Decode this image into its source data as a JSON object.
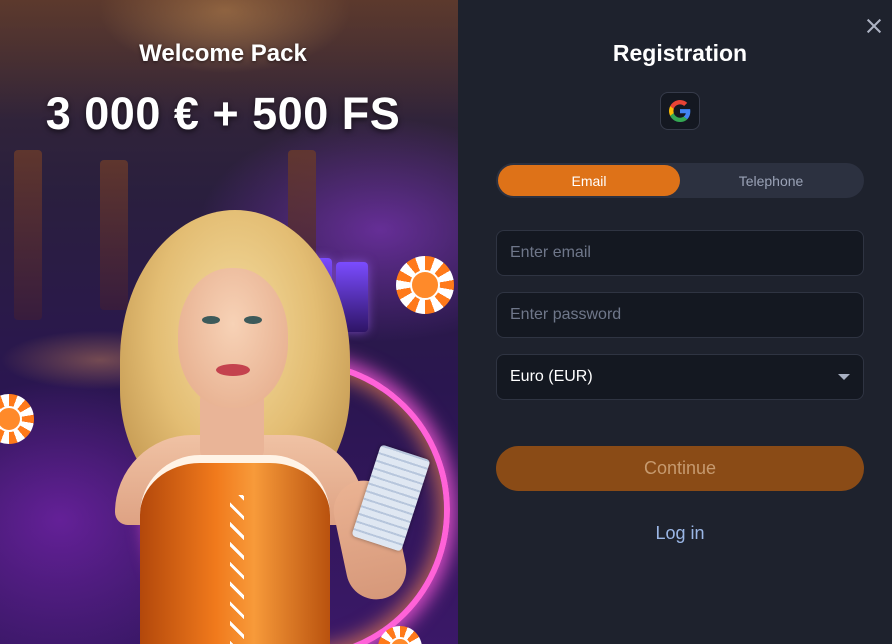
{
  "promo": {
    "title": "Welcome Pack",
    "amount": "3 000 € + 500 FS"
  },
  "registration": {
    "title": "Registration",
    "social": {
      "provider_icon": "google-icon"
    },
    "tabs": [
      {
        "label": "Email",
        "active": true
      },
      {
        "label": "Telephone",
        "active": false
      }
    ],
    "email": {
      "placeholder": "Enter email",
      "value": ""
    },
    "password": {
      "placeholder": "Enter password",
      "value": ""
    },
    "currency": {
      "selected": "Euro (EUR)"
    },
    "continue_label": "Continue",
    "login_label": "Log in"
  },
  "colors": {
    "accent": "#de7218",
    "continue_bg": "#8a4b16",
    "panel_bg": "#1e222d",
    "input_bg": "#141821",
    "link": "#9bb7e6"
  },
  "icons": [
    "close-icon",
    "google-icon",
    "chevron-down-icon"
  ]
}
